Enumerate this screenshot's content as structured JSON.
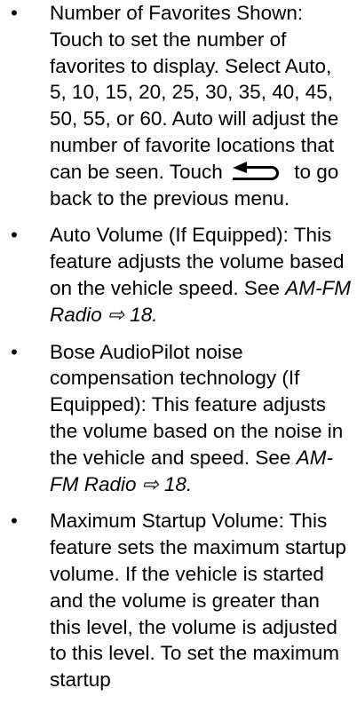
{
  "items": [
    {
      "text_before_icon": "Number of Favorites Shown: Touch to set the number of favorites to display. Select Auto, 5, 10, 15, 20, 25, 30, 35, 40, 45, 50, 55, or 60. Auto will adjust the number of favorite locations that can be seen. Touch",
      "icon": "back-arrow-icon",
      "text_after_icon": "to go back to the previous menu."
    },
    {
      "text": "Auto Volume (If Equipped): This feature adjusts the volume based on the vehicle speed. See",
      "ref": "AM-FM Radio",
      "arrow": "⇨",
      "page": "18",
      "end": "."
    },
    {
      "text": "Bose AudioPilot noise compensation technology (If Equipped): This feature adjusts the volume based on the noise in the vehicle and speed. See",
      "ref": "AM-FM Radio",
      "arrow": "⇨",
      "page": "18",
      "end": "."
    },
    {
      "text": "Maximum Startup Volume: This feature sets the maximum startup volume. If the vehicle is started and the volume is greater than this level, the volume is adjusted to this level. To set the maximum startup"
    }
  ],
  "bullet": "•"
}
